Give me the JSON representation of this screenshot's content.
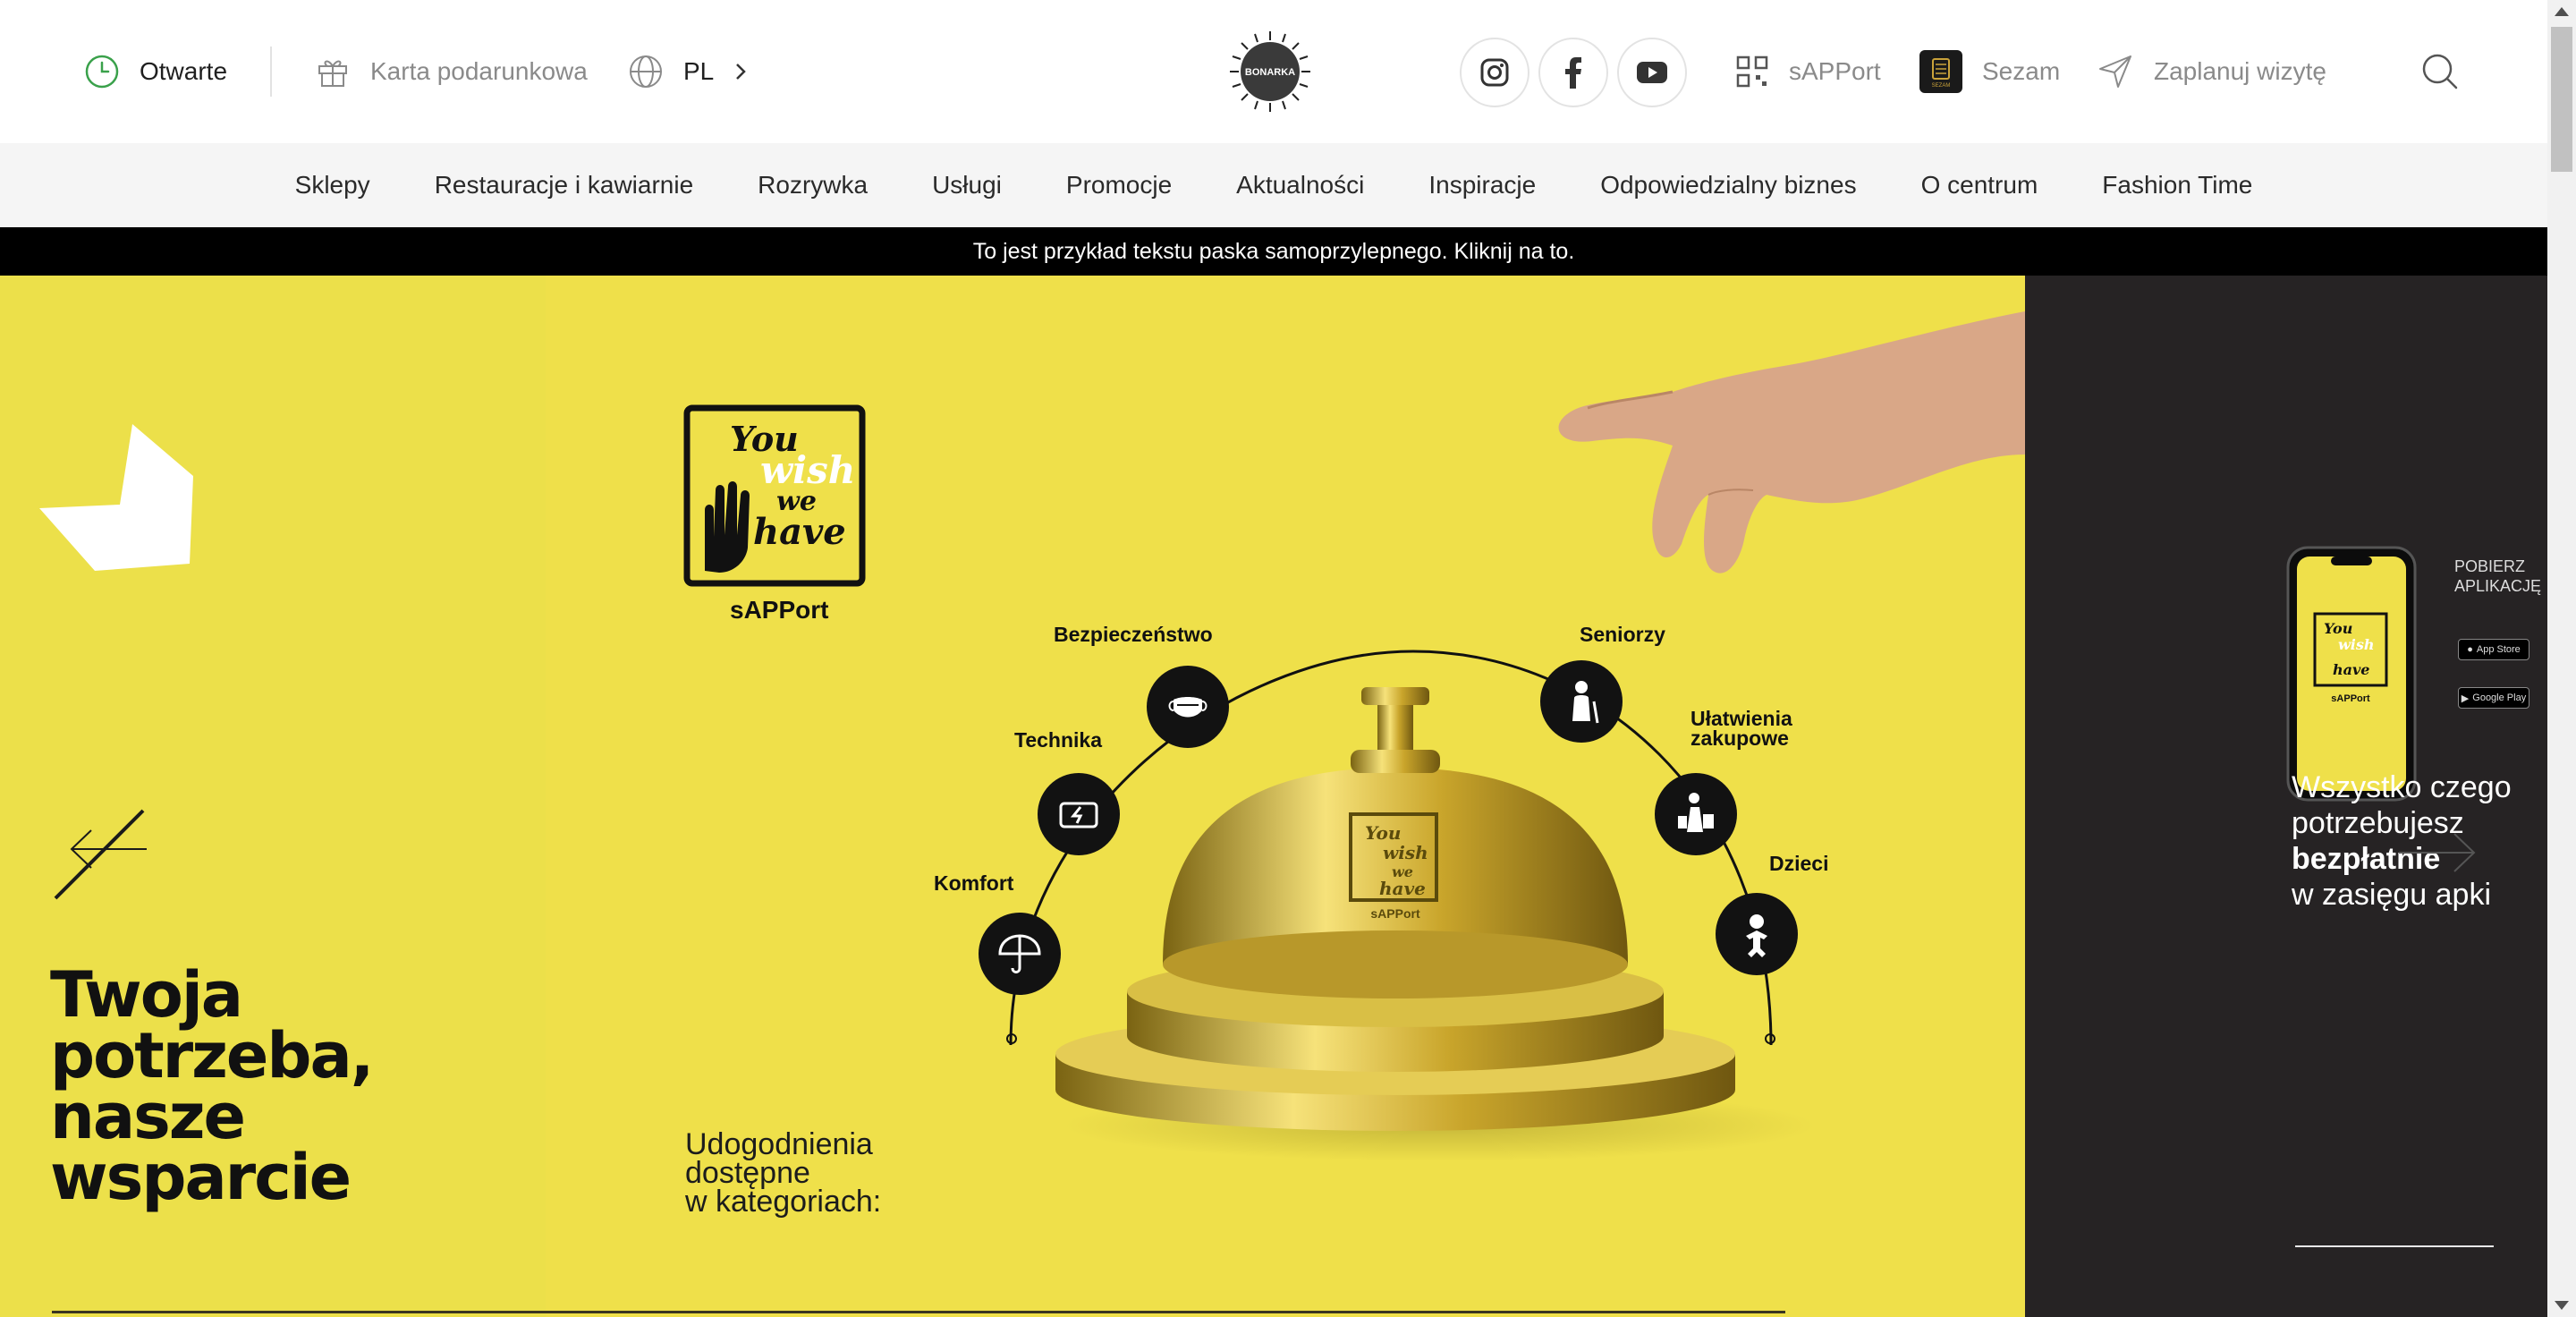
{
  "topbar": {
    "status": "Otwarte",
    "gift_card": "Karta podarunkowa",
    "language": "PL",
    "logo_text": "BONARKA",
    "sapport": "sAPPort",
    "sezam": "Sezam",
    "sezam_badge": "SEZAM",
    "plan_visit": "Zaplanuj wizytę"
  },
  "nav": {
    "items": [
      "Sklepy",
      "Restauracje i kawiarnie",
      "Rozrywka",
      "Usługi",
      "Promocje",
      "Aktualności",
      "Inspiracje",
      "Odpowiedzialny biznes",
      "O centrum",
      "Fashion Time"
    ]
  },
  "strip": {
    "text": "To jest przykład tekstu paska samoprzylepnego. Kliknij na to."
  },
  "hero": {
    "headline": [
      "Twoja",
      "potrzeba,",
      "nasze",
      "wsparcie"
    ],
    "logo_lines": [
      "You",
      "wish",
      "we",
      "have"
    ],
    "logo_caption": "sAPPort",
    "categories_intro": [
      "Udogodnienia",
      "dostępne",
      "w kategoriach:"
    ],
    "categories": {
      "komfort": "Komfort",
      "technika": "Technika",
      "bezpieczenstwo": "Bezpieczeństwo",
      "seniorzy": "Seniorzy",
      "ulatwienia_1": "Ułatwienia",
      "ulatwienia_2": "zakupowe",
      "dzieci": "Dzieci"
    },
    "bell_caption": "sAPPort",
    "next_slide": {
      "line1": "Wszystko czego",
      "line2": "potrzebujesz",
      "line3": "bezpłatnie",
      "line4": "w zasięgu apki",
      "download_1": "POBIERZ",
      "download_2": "APLIKACJĘ",
      "app_store": "App Store",
      "google_play": "Google Play"
    }
  },
  "colors": {
    "hero_yellow": "#efe04a",
    "next_slide_dark": "#262324",
    "open_green": "#3aa14b",
    "strip_black": "#000000"
  }
}
